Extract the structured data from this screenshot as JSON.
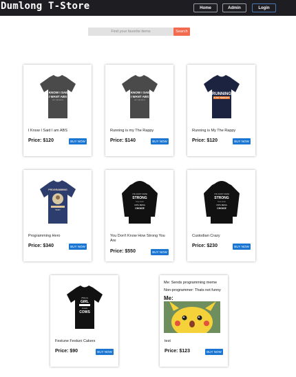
{
  "header": {
    "brand": "Dumlong T-Store",
    "nav": [
      {
        "label": "Home"
      },
      {
        "label": "Admin"
      },
      {
        "label": "Login"
      }
    ]
  },
  "search": {
    "placeholder": "Find your favorite items",
    "button_label": "Search"
  },
  "buy_label": "BUY NOW",
  "products": [
    {
      "name": "I Know I Said I am ABS",
      "price": "Price: $120",
      "shirt_color": "#4a4a4a",
      "print_text": [
        "I KNOW I SAID",
        "I WANT ABS"
      ]
    },
    {
      "name": "Running is my The Rappy",
      "price": "Price: $140",
      "shirt_color": "#4a4a4a",
      "print_text": [
        "I KNOW I SAID",
        "I WANT ABS"
      ]
    },
    {
      "name": "Running is My The Rappy",
      "price": "Price: $120",
      "shirt_color": "#1c2341",
      "print_text": [
        "RUNNING",
        "IS MY THERAPY"
      ]
    },
    {
      "name": "Programming Hero",
      "price": "Price: $340",
      "shirt_color": "#2c3d6e",
      "print_text": [
        "PROGRAMMING",
        "HERO"
      ]
    },
    {
      "name": "You Don't Know How Strong You Are",
      "price": "Price: $550",
      "shirt_color": "#111111",
      "print_text": [
        "YOU DON'T KNOW",
        "STRONG"
      ]
    },
    {
      "name": "Custodian Crazy",
      "price": "Price: $230",
      "shirt_color": "#111111",
      "print_text": [
        "YOU DON'T KNOW",
        "STRONG"
      ]
    },
    {
      "name": "Festune Festuni Cakers",
      "price": "Price: $90",
      "shirt_color": "#111111",
      "print_text": [
        "GIRL",
        "COWS"
      ]
    },
    {
      "name": "test",
      "price": "Price: $123",
      "meme": {
        "line1": "Me: Sends programming meme",
        "line2": "Non-programmer: Thats not funny",
        "line3": "Me:"
      }
    }
  ]
}
